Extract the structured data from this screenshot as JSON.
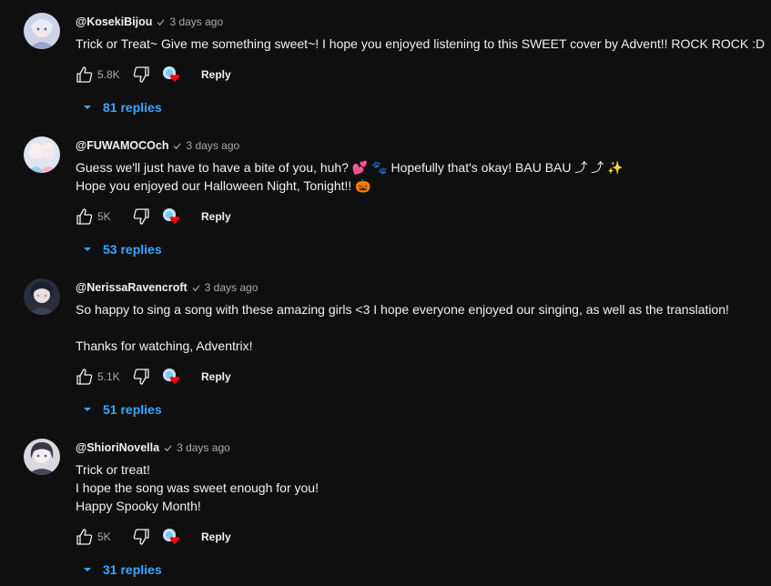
{
  "colors": {
    "background": "#0f0f0f",
    "text": "#f1f1f1",
    "secondary": "#aaaaaa",
    "link": "#3ea6ff",
    "heart": "#ff0000"
  },
  "comments": [
    {
      "handle": "@KosekiBijou",
      "time": "3 days ago",
      "lines": [
        "Trick or Treat~ Give me something sweet~! I hope you enjoyed listening to this SWEET cover by Advent!! ROCK ROCK :D"
      ],
      "likes": "5.8K",
      "reply_label": "Reply",
      "replies_label": "81 replies",
      "avatar_icon": "avatar-koseki-bijou"
    },
    {
      "handle": "@FUWAMOCOch",
      "time": "3 days ago",
      "lines": [
        "Guess we'll just have to have a bite of you, huh? 💕 🐾 Hopefully that's okay! BAU BAU ⤴ ⤴ ✨",
        "Hope you enjoyed our Halloween Night, Tonight!! 🎃"
      ],
      "likes": "5K",
      "reply_label": "Reply",
      "replies_label": "53 replies",
      "avatar_icon": "avatar-fuwamoco"
    },
    {
      "handle": "@NerissaRavencroft",
      "time": "3 days ago",
      "lines": [
        "So happy to sing a song with these amazing girls <3 I hope everyone enjoyed our singing, as well as the translation!",
        "",
        "Thanks for watching, Adventrix!"
      ],
      "likes": "5.1K",
      "reply_label": "Reply",
      "replies_label": "51 replies",
      "avatar_icon": "avatar-nerissa-ravencroft"
    },
    {
      "handle": "@ShioriNovella",
      "time": "3 days ago",
      "lines": [
        "Trick or treat!",
        "I hope the song was sweet enough for you!",
        "Happy Spooky Month!"
      ],
      "likes": "5K",
      "reply_label": "Reply",
      "replies_label": "31 replies",
      "avatar_icon": "avatar-shiori-novella"
    }
  ]
}
